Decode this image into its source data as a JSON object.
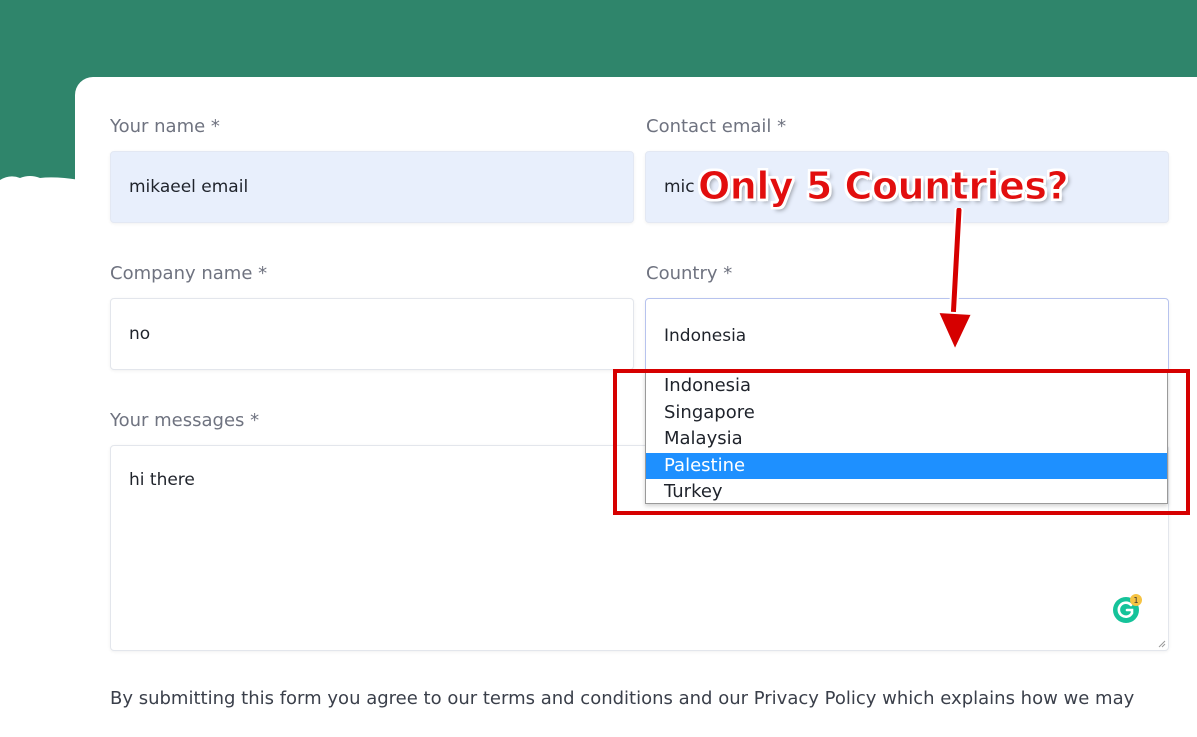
{
  "form": {
    "name": {
      "label": "Your name *",
      "value": "mikaeel email"
    },
    "email": {
      "label": "Contact email *",
      "value": "mic"
    },
    "company": {
      "label": "Company name *",
      "value": "no"
    },
    "country": {
      "label": "Country *",
      "value": "Indonesia",
      "options": [
        "Indonesia",
        "Singapore",
        "Malaysia",
        "Palestine",
        "Turkey"
      ],
      "highlighted_option": "Palestine"
    },
    "message": {
      "label": "Your messages *",
      "value": "hi there"
    }
  },
  "annotation": {
    "text": "Only 5 Countries?",
    "color": "#e20e0e"
  },
  "grammarly": {
    "badge_count": "1"
  },
  "footer": {
    "text": "By submitting this form you agree to our terms and conditions and our Privacy Policy which explains how we may"
  },
  "colors": {
    "header_green": "#2f856b",
    "autofill_bg": "#e8effc",
    "highlight": "#1e90ff",
    "annotation_red": "#d60000"
  }
}
